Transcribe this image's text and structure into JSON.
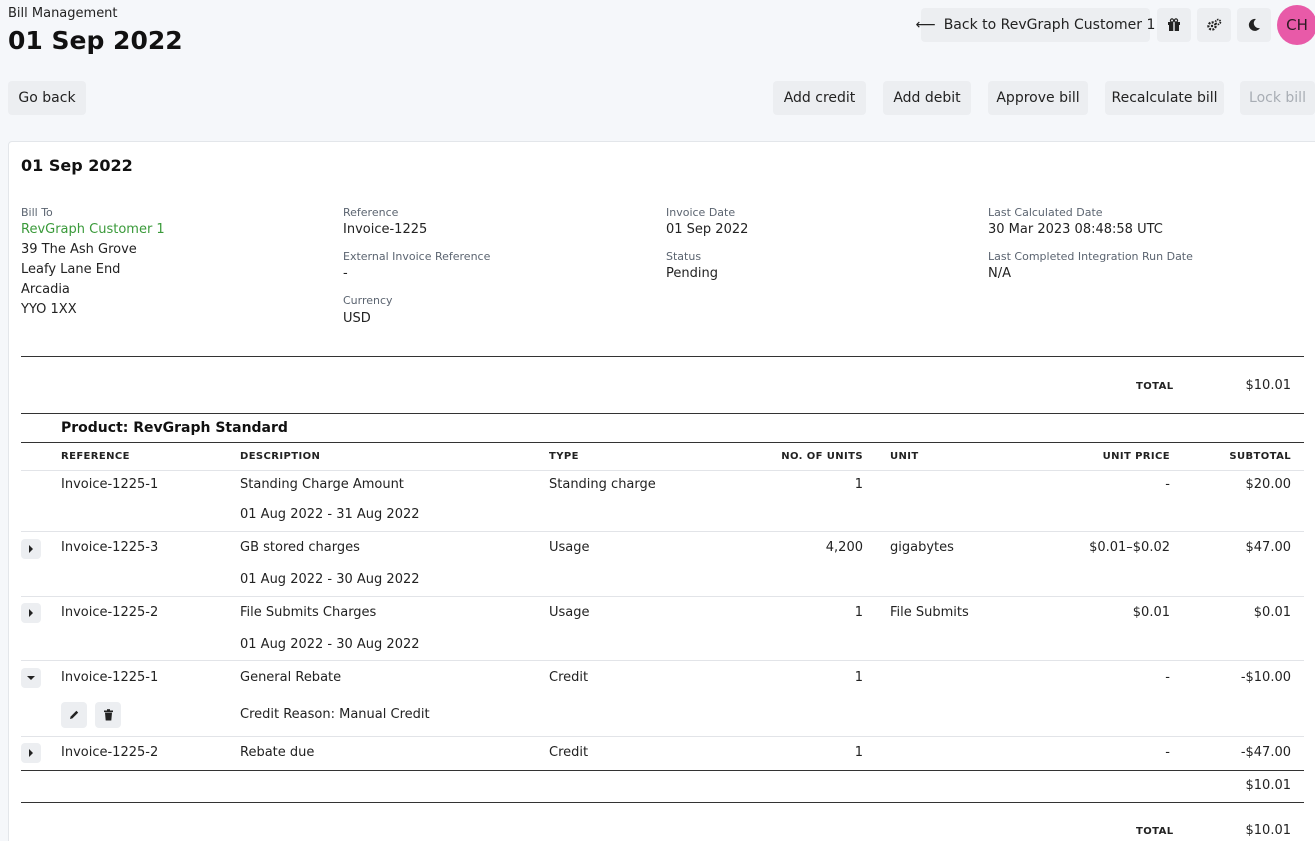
{
  "header": {
    "breadcrumb": "Bill Management",
    "title": "01 Sep 2022",
    "back_label": "Back to RevGraph Customer 1",
    "avatar_initials": "CH"
  },
  "toolbar": {
    "go_back": "Go back",
    "add_credit": "Add credit",
    "add_debit": "Add debit",
    "approve": "Approve bill",
    "recalculate": "Recalculate bill",
    "lock": "Lock bill"
  },
  "bill": {
    "title": "01 Sep 2022",
    "bill_to_label": "Bill To",
    "customer": "RevGraph Customer 1",
    "address": [
      "39 The Ash Grove",
      "Leafy Lane End",
      "Arcadia",
      "YYO 1XX"
    ],
    "reference_label": "Reference",
    "reference": "Invoice-1225",
    "ext_ref_label": "External Invoice Reference",
    "ext_ref": "-",
    "currency_label": "Currency",
    "currency": "USD",
    "invoice_date_label": "Invoice Date",
    "invoice_date": "01 Sep 2022",
    "status_label": "Status",
    "status": "Pending",
    "last_calc_label": "Last Calculated Date",
    "last_calc": "30 Mar 2023 08:48:58 UTC",
    "last_run_label": "Last Completed Integration Run Date",
    "last_run": "N/A",
    "total_label": "TOTAL",
    "total": "$10.01"
  },
  "product": {
    "title": "Product: RevGraph Standard",
    "columns": [
      "REFERENCE",
      "DESCRIPTION",
      "TYPE",
      "NO. OF UNITS",
      "UNIT",
      "UNIT PRICE",
      "SUBTOTAL"
    ],
    "rows": [
      {
        "reference": "Invoice-1225-1",
        "description": "Standing Charge Amount",
        "period": "01 Aug 2022 - 31 Aug 2022",
        "type": "Standing charge",
        "units": "1",
        "unit": "",
        "unit_price": "-",
        "subtotal": "$20.00"
      },
      {
        "reference": "Invoice-1225-3",
        "description": "GB stored charges",
        "period": "01 Aug 2022 - 30 Aug 2022",
        "type": "Usage",
        "units": "4,200",
        "unit": "gigabytes",
        "unit_price": "$0.01–$0.02",
        "subtotal": "$47.00"
      },
      {
        "reference": "Invoice-1225-2",
        "description": "File Submits Charges",
        "period": "01 Aug 2022 - 30 Aug 2022",
        "type": "Usage",
        "units": "1",
        "unit": "File Submits",
        "unit_price": "$0.01",
        "subtotal": "$0.01"
      },
      {
        "reference": "Invoice-1225-1",
        "description": "General Rebate",
        "period": "Credit Reason: Manual Credit",
        "type": "Credit",
        "units": "1",
        "unit": "",
        "unit_price": "-",
        "subtotal": "-$10.00"
      },
      {
        "reference": "Invoice-1225-2",
        "description": "Rebate due",
        "period": "",
        "type": "Credit",
        "units": "1",
        "unit": "",
        "unit_price": "-",
        "subtotal": "-$47.00"
      }
    ],
    "product_total": "$10.01",
    "grand_total_label": "TOTAL",
    "grand_total": "$10.01"
  }
}
